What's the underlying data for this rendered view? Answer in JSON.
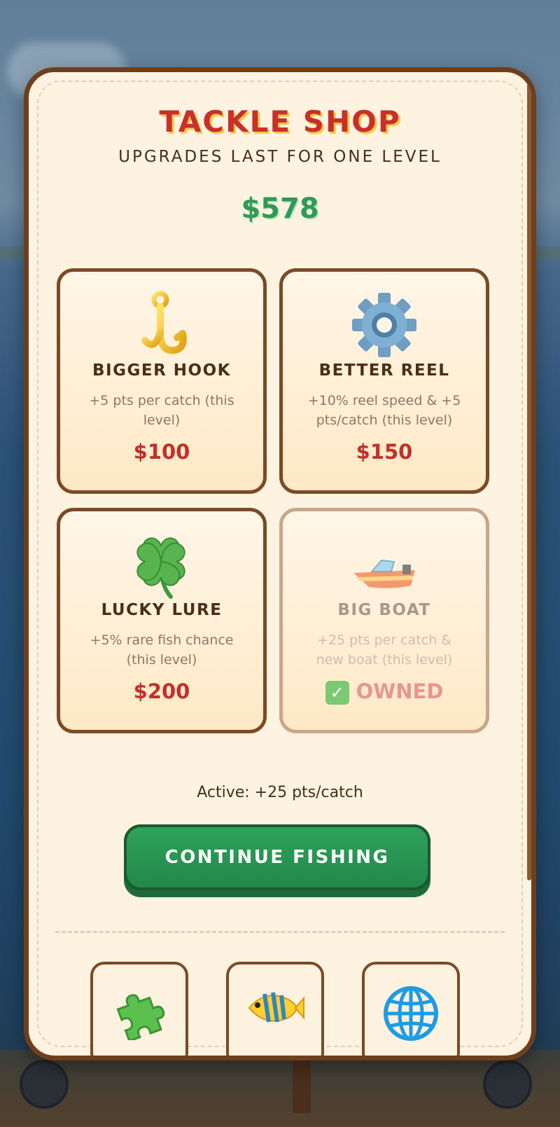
{
  "shop": {
    "title": "TACKLE SHOP",
    "subtitle": "UPGRADES LAST FOR ONE LEVEL",
    "money": "$578"
  },
  "items": [
    {
      "name": "BIGGER HOOK",
      "desc": "+5 pts per catch (this level)",
      "price": "$100",
      "icon": "hook-icon",
      "owned": false
    },
    {
      "name": "BETTER REEL",
      "desc": "+10% reel speed & +5 pts/catch (this level)",
      "price": "$150",
      "icon": "gear-icon",
      "owned": false
    },
    {
      "name": "LUCKY LURE",
      "desc": "+5% rare fish chance (this level)",
      "price": "$200",
      "icon": "four-leaf-clover-icon",
      "owned": false
    },
    {
      "name": "BIG BOAT",
      "desc": "+25 pts per catch & new boat (this level)",
      "price": "OWNED",
      "icon": "speedboat-icon",
      "owned": true
    }
  ],
  "active": "Active: +25 pts/catch",
  "continue_label": "CONTINUE FISHING",
  "nav": [
    {
      "icon": "puzzle-piece-icon"
    },
    {
      "icon": "tropical-fish-icon"
    },
    {
      "icon": "globe-icon"
    }
  ],
  "colors": {
    "title": "#c8302a",
    "money": "#2f9a53",
    "price": "#c2302a",
    "button": "#2fa25b",
    "panel": "#fdf3e0",
    "border": "#6e3f1c"
  }
}
